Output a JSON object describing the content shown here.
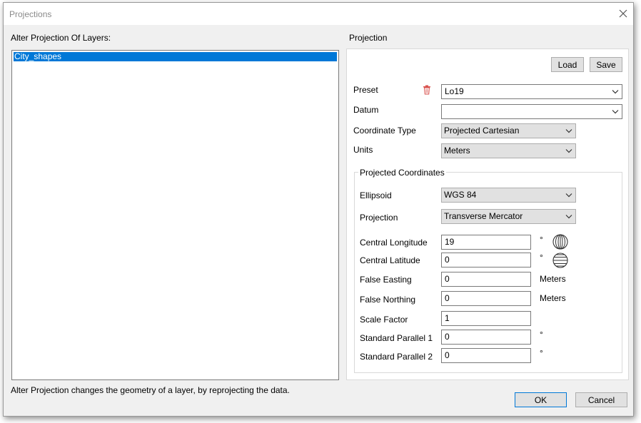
{
  "window": {
    "title": "Projections",
    "close_label": "✕"
  },
  "layers": {
    "header": "Alter Projection Of Layers:",
    "items": [
      {
        "label": "City_shapes",
        "selected": true
      }
    ]
  },
  "projection": {
    "header": "Projection",
    "load_label": "Load",
    "save_label": "Save",
    "preset_label": "Preset",
    "preset_value": "Lo19",
    "datum_label": "Datum",
    "datum_value": "",
    "coord_type_label": "Coordinate Type",
    "coord_type_value": "Projected Cartesian",
    "units_label": "Units",
    "units_value": "Meters",
    "group_title": "Projected Coordinates",
    "ellipsoid_label": "Ellipsoid",
    "ellipsoid_value": "WGS 84",
    "projection_label": "Projection",
    "projection_value": "Transverse Mercator",
    "central_longitude_label": "Central Longitude",
    "central_longitude_value": "19",
    "central_longitude_unit": "°",
    "central_latitude_label": "Central Latitude",
    "central_latitude_value": "0",
    "central_latitude_unit": "°",
    "false_easting_label": "False Easting",
    "false_easting_value": "0",
    "false_easting_unit": "Meters",
    "false_northing_label": "False Northing",
    "false_northing_value": "0",
    "false_northing_unit": "Meters",
    "scale_factor_label": "Scale Factor",
    "scale_factor_value": "1",
    "std_parallel_1_label": "Standard Parallel 1",
    "std_parallel_1_value": "0",
    "std_parallel_1_unit": "°",
    "std_parallel_2_label": "Standard Parallel 2",
    "std_parallel_2_value": "0",
    "std_parallel_2_unit": "°"
  },
  "status": {
    "text": "Alter Projection changes the geometry of a layer, by reprojecting the data."
  },
  "footer": {
    "ok_label": "OK",
    "cancel_label": "Cancel"
  },
  "colors": {
    "selection": "#0078d7",
    "delete_icon": "#d9534f"
  },
  "icons": {
    "delete": "trash-icon",
    "longitude": "longitude-globe-icon",
    "latitude": "latitude-globe-icon",
    "dropdown": "chevron-down-icon"
  }
}
